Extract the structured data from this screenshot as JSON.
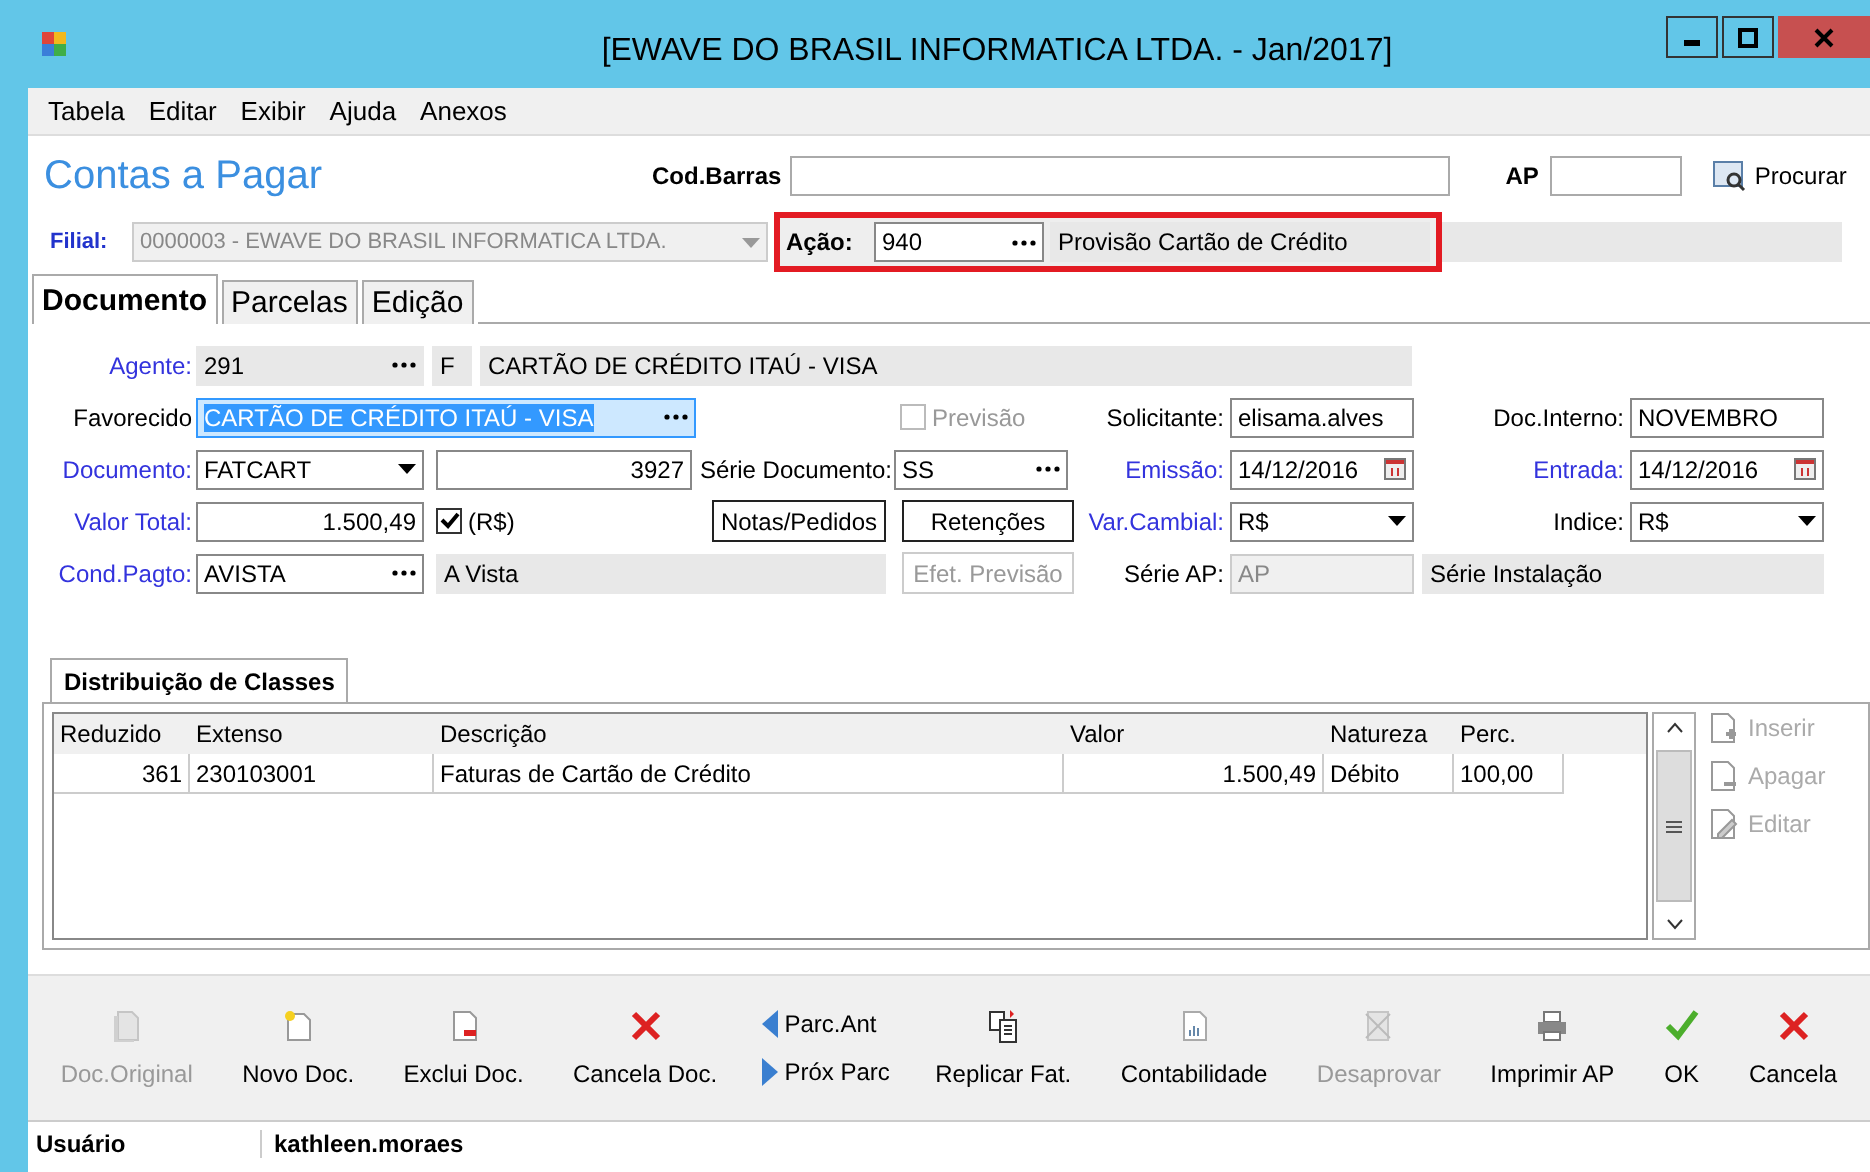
{
  "window": {
    "title": "[EWAVE DO BRASIL INFORMATICA LTDA. - Jan/2017]"
  },
  "menu": [
    "Tabela",
    "Editar",
    "Exibir",
    "Ajuda",
    "Anexos"
  ],
  "header": {
    "title": "Contas a Pagar",
    "barcode_label": "Cod.Barras",
    "ap_label": "AP",
    "search_button": "Procurar"
  },
  "filial": {
    "label": "Filial:",
    "value": "0000003 - EWAVE DO BRASIL INFORMATICA LTDA.",
    "disabled": true
  },
  "acao": {
    "label": "Ação:",
    "code": "940",
    "description": "Provisão Cartão de Crédito",
    "highlighted": true
  },
  "tabs": [
    {
      "label": "Documento",
      "selected": true
    },
    {
      "label": "Parcelas",
      "selected": false
    },
    {
      "label": "Edição",
      "selected": false
    }
  ],
  "agente": {
    "label": "Agente:",
    "required": true,
    "value": "291",
    "type": "F",
    "name": "CARTÃO DE CRÉDITO ITAÚ - VISA",
    "disabled": true
  },
  "favorecido": {
    "label": "Favorecido",
    "required": false,
    "value": "CARTÃO DE CRÉDITO ITAÚ - VISA",
    "selected": true
  },
  "previsao": {
    "label": "Previsão",
    "checked": false,
    "disabled": true
  },
  "solicitante": {
    "label": "Solicitante:",
    "required": false,
    "value": "elisama.alves"
  },
  "doc_interno": {
    "label": "Doc.Interno:",
    "required": false,
    "value": "NOVEMBRO"
  },
  "documento": {
    "label": "Documento:",
    "required": true,
    "value": "FATCART",
    "number": "3927"
  },
  "serie_documento": {
    "label": "Série Documento:",
    "required": false,
    "value": "SS"
  },
  "emissao": {
    "label": "Emissão:",
    "required": true,
    "value": "14/12/2016"
  },
  "entrada": {
    "label": "Entrada:",
    "required": true,
    "value": "14/12/2016"
  },
  "valor_total": {
    "label": "Valor Total:",
    "required": true,
    "value": "1.500,49",
    "checked": true,
    "currency": "(R$)"
  },
  "notas_button": {
    "label": "Notas/Pedidos",
    "disabled": false
  },
  "retencoes_button": {
    "label": "Retenções",
    "disabled": false
  },
  "var_cambial": {
    "label": "Var.Cambial:",
    "required": true,
    "value": "R$"
  },
  "indice": {
    "label": "Indice:",
    "required": false,
    "value": "R$"
  },
  "cond_pagto": {
    "label": "Cond.Pagto:",
    "required": true,
    "value": "AVISTA",
    "description": "A Vista"
  },
  "efet_previsao_button": {
    "label": "Efet. Previsão",
    "disabled": true
  },
  "serie_ap": {
    "label": "Série AP:",
    "required": false,
    "value": "AP",
    "description": "Série Instalação",
    "disabled": true
  },
  "classes": {
    "tab": "Distribuição de Classes",
    "columns": [
      "Reduzido",
      "Extenso",
      "Descrição",
      "Valor",
      "Natureza",
      "Perc."
    ],
    "rows": [
      [
        "361",
        "230103001",
        "Faturas de Cartão de Crédito",
        "1.500,49",
        "Débito",
        "100,00"
      ]
    ],
    "actions": [
      {
        "label": "Inserir",
        "kind": "add",
        "disabled": true
      },
      {
        "label": "Apagar",
        "kind": "remove",
        "disabled": true
      },
      {
        "label": "Editar",
        "kind": "edit",
        "disabled": true
      }
    ]
  },
  "toolbar": [
    {
      "label": "Doc.Original",
      "kind": "copy",
      "disabled": true
    },
    {
      "label": "Novo Doc.",
      "kind": "new",
      "disabled": false
    },
    {
      "label": "Exclui Doc.",
      "kind": "delete",
      "disabled": false
    },
    {
      "label": "Cancela Doc.",
      "kind": "cancel",
      "disabled": false
    },
    {
      "label": "Replicar Fat.",
      "kind": "replicate",
      "disabled": false
    },
    {
      "label": "Contabilidade",
      "kind": "report",
      "disabled": false
    },
    {
      "label": "Desaprovar",
      "kind": "disapprove",
      "disabled": true
    },
    {
      "label": "Imprimir AP",
      "kind": "print",
      "disabled": false
    },
    {
      "label": "OK",
      "kind": "ok",
      "disabled": false
    },
    {
      "label": "Cancela",
      "kind": "cancel",
      "disabled": false
    }
  ],
  "parcel_nav": [
    {
      "label": "Parc.Ant",
      "kind": "previous"
    },
    {
      "label": "Próx Parc",
      "kind": "next"
    }
  ],
  "status_bar": {
    "label": "Usuário",
    "value": "kathleen.moraes"
  }
}
